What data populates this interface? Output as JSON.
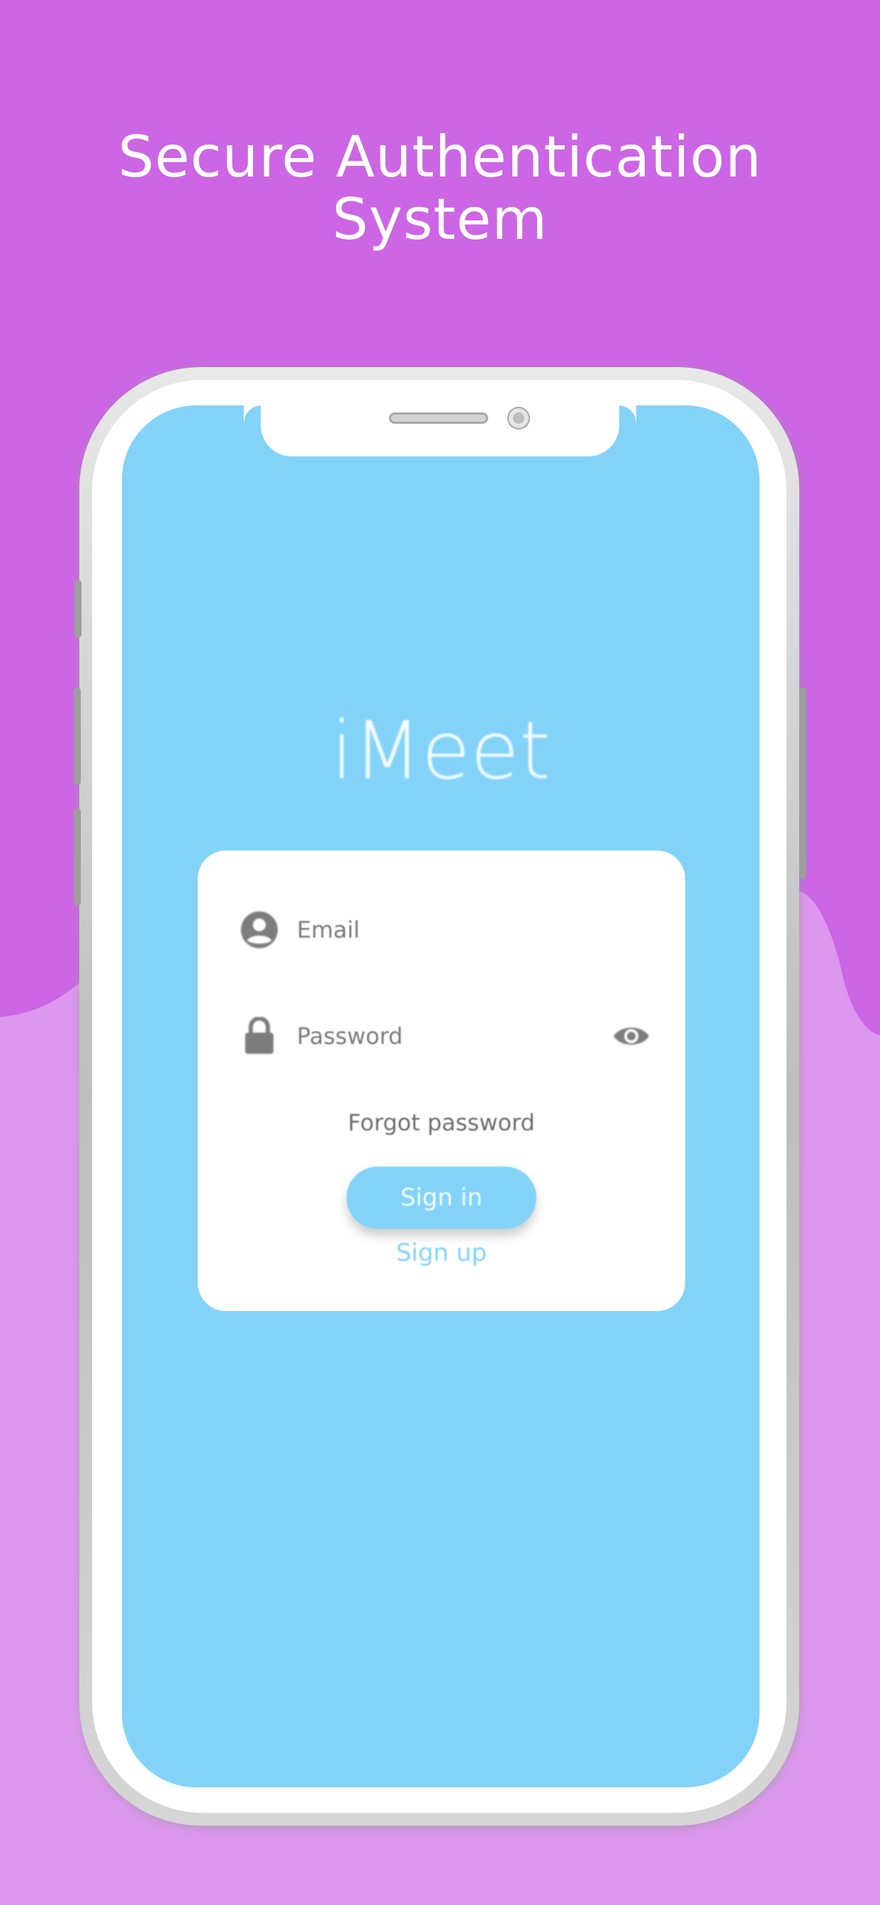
{
  "promo": {
    "headline_line1": "Secure Authentication",
    "headline_line2": "System"
  },
  "app": {
    "title": "iMeet"
  },
  "login_form": {
    "email_placeholder": "Email",
    "password_placeholder": "Password",
    "forgot_password_label": "Forgot password",
    "sign_in_label": "Sign in",
    "sign_up_label": "Sign up"
  },
  "icons": {
    "email": "account-circle-icon",
    "password": "lock-icon",
    "toggle_visibility": "eye-icon"
  },
  "colors": {
    "background_top": "#cc66e4",
    "background_bottom": "#dc97ee",
    "screen": "#83d3f9",
    "accent": "#83d3f9",
    "card": "#ffffff"
  }
}
